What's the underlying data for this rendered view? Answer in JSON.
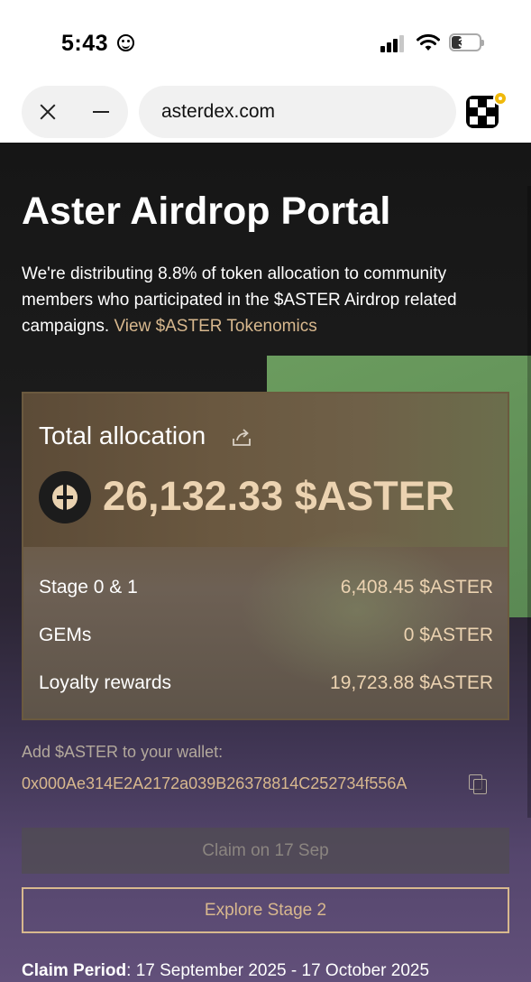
{
  "status_bar": {
    "time": "5:43",
    "battery": "35",
    "battery_level": 0.35
  },
  "browser": {
    "url": "asterdex.com",
    "icons": [
      "close-icon",
      "minimize-icon",
      "app-icon"
    ]
  },
  "page": {
    "title": "Aster Airdrop Portal",
    "intro_text": "We're distributing 8.8% of token allocation to community members who participated in the $ASTER Airdrop related campaigns. ",
    "intro_link": "View $ASTER Tokenomics"
  },
  "allocation": {
    "label": "Total allocation",
    "total": "26,132.33 $ASTER",
    "rows": [
      {
        "label": "Stage 0 & 1",
        "value": "6,408.45 $ASTER"
      },
      {
        "label": "GEMs",
        "value": "0 $ASTER"
      },
      {
        "label": "Loyalty rewards",
        "value": "19,723.88 $ASTER"
      }
    ]
  },
  "wallet": {
    "label": "Add $ASTER to your wallet:",
    "address": "0x000Ae314E2A2172a039B26378814C252734f556A"
  },
  "buttons": {
    "claim": "Claim on 17 Sep",
    "explore": "Explore Stage 2"
  },
  "claim_period": {
    "label": "Claim Period",
    "value": ": 17 September 2025 - 17 October 2025"
  },
  "colors": {
    "accent": "#d8b88e",
    "amount": "#ecd3b1",
    "panel_green": "#62925a"
  }
}
